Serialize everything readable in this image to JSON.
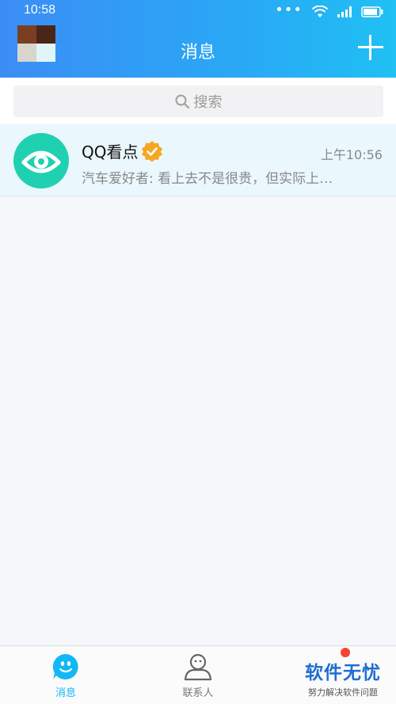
{
  "status_bar": {
    "time": "10:58",
    "dots": "•••"
  },
  "header": {
    "title": "消息"
  },
  "search": {
    "placeholder": "搜索"
  },
  "conversations": [
    {
      "name": "QQ看点",
      "time": "上午10:56",
      "message": "汽车爱好者: 看上去不是很贵，但实际上…",
      "verified": true
    }
  ],
  "bottom_nav": {
    "items": [
      {
        "label": "消息",
        "active": true
      },
      {
        "label": "联系人",
        "active": false
      }
    ]
  },
  "watermark": {
    "title": "软件无忧",
    "subtitle": "努力解决软件问题"
  },
  "colors": {
    "header_start": "#3b8df5",
    "header_end": "#20c0f4",
    "accent": "#12b7f5",
    "brand_teal": "#1fd1b0",
    "verified_orange": "#f5a623",
    "badge_red": "#f44336"
  }
}
